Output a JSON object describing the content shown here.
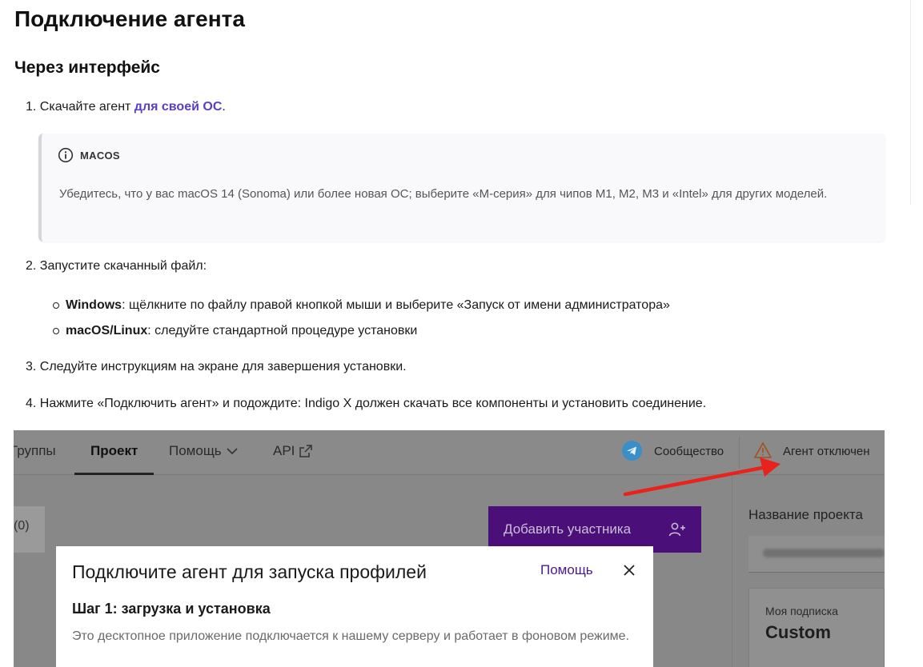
{
  "page_title": "Подключение агента",
  "section_title": "Через интерфейс",
  "steps": {
    "s1_prefix": "1. Скачайте агент ",
    "s1_link": "для своей ОС",
    "s1_suffix": ".",
    "s2": "2. Запустите скачанный файл:",
    "s3": "3. Следуйте инструкциям на экране для завершения установки.",
    "s4": "4. Нажмите «Подключить агент» и подождите: Indigo X должен скачать все компоненты и установить соединение."
  },
  "note": {
    "icon": "info-icon",
    "title": "MACOS",
    "text": "Убедитесь, что у вас macOS 14 (Sonoma) или более новая ОС; выберите «M-серия» для чипов M1, M2, M3 и «Intel» для других моделей."
  },
  "bullets": [
    {
      "bold": "Windows",
      "text": ": щёлкните по файлу правой кнопкой мыши и выберите «Запуск от имени администратора»"
    },
    {
      "bold": "macOS/Linux",
      "text": ": следуйте стандартной процедуре установки"
    }
  ],
  "screenshot": {
    "tabs": {
      "groups": "Группы",
      "project": "Проект",
      "help": "Помощь",
      "api": "API"
    },
    "community": "Сообщество",
    "agent_status": "Агент отключен",
    "left_button": "(0)",
    "add_member": "Добавить участника",
    "project_name_label": "Название проекта",
    "subscription_label": "Моя подписка",
    "subscription_value": "Custom",
    "modal": {
      "title": "Подключите агент для запуска профилей",
      "help": "Помощь",
      "step": "Шаг 1: загрузка и установка",
      "desc": "Это десктопное приложение подключается к нашему серверу и работает в фоновом режиме."
    }
  },
  "colors": {
    "link": "#5a3fc0",
    "accent_purple": "#4b0f7a",
    "arrow_red": "#e8231e",
    "telegram_blue": "#3a8fc9"
  }
}
